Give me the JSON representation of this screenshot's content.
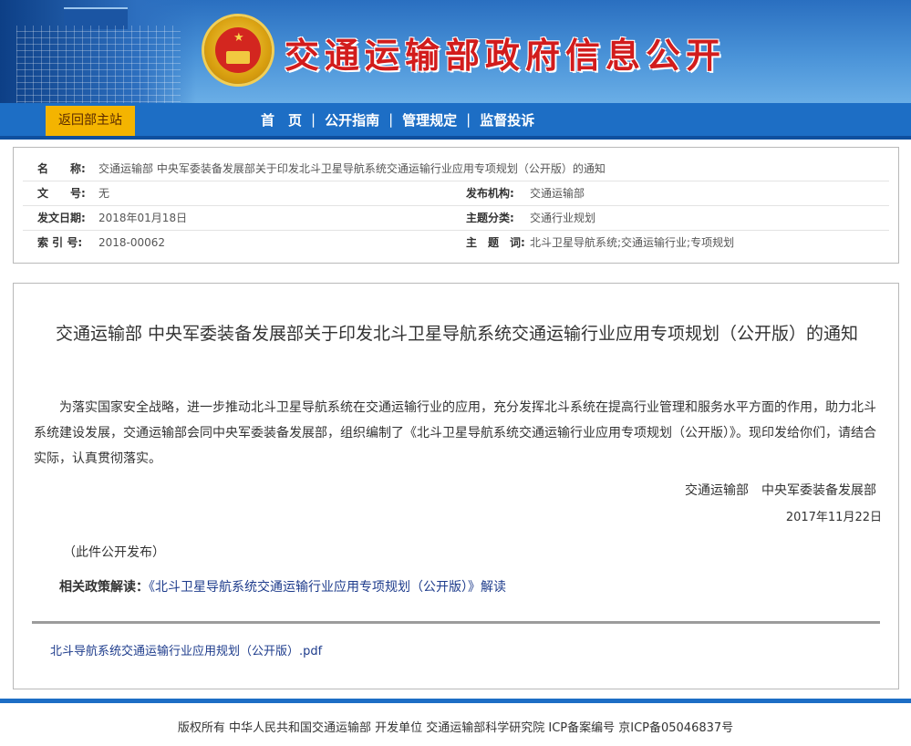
{
  "header": {
    "site_title": "交通运输部政府信息公开"
  },
  "nav": {
    "home_button": "返回部主站",
    "links": [
      "首　页",
      "公开指南",
      "管理规定",
      "监督投诉"
    ],
    "separator": "|"
  },
  "meta": {
    "name_label": "名　　称:",
    "name_value": "交通运输部 中央军委装备发展部关于印发北斗卫星导航系统交通运输行业应用专项规划（公开版）的通知",
    "doc_no_label": "文　　号:",
    "doc_no_value": "无",
    "issuer_label": "发布机构:",
    "issuer_value": "交通运输部",
    "date_label": "发文日期:",
    "date_value": "2018年01月18日",
    "category_label": "主题分类:",
    "category_value": "交通行业规划",
    "index_label": "索 引 号:",
    "index_value": "2018-00062",
    "keywords_label": "主　题　词:",
    "keywords_value": "北斗卫星导航系统;交通运输行业;专项规划"
  },
  "doc": {
    "title": "交通运输部 中央军委装备发展部关于印发北斗卫星导航系统交通运输行业应用专项规划（公开版）的通知",
    "body": "为落实国家安全战略，进一步推动北斗卫星导航系统在交通运输行业的应用，充分发挥北斗系统在提高行业管理和服务水平方面的作用，助力北斗系统建设发展，交通运输部会同中央军委装备发展部，组织编制了《北斗卫星导航系统交通运输行业应用专项规划（公开版）》。现印发给你们，请结合实际，认真贯彻落实。",
    "signature_org": "交通运输部　中央军委装备发展部",
    "signature_date": "2017年11月22日",
    "publish_note": "（此件公开发布）",
    "related_label": "相关政策解读：",
    "related_link": "《北斗卫星导航系统交通运输行业应用专项规划（公开版）》解读",
    "attachment": "北斗导航系统交通运输行业应用规划（公开版）.pdf"
  },
  "footer": {
    "text": "版权所有 中华人民共和国交通运输部 开发单位 交通运输部科学研究院 ICP备案编号 京ICP备05046837号"
  },
  "colors": {
    "nav_blue": "#1d6ec5",
    "title_red": "#d21c1c",
    "home_orange": "#f4b400",
    "link_blue": "#1e3c8c"
  }
}
